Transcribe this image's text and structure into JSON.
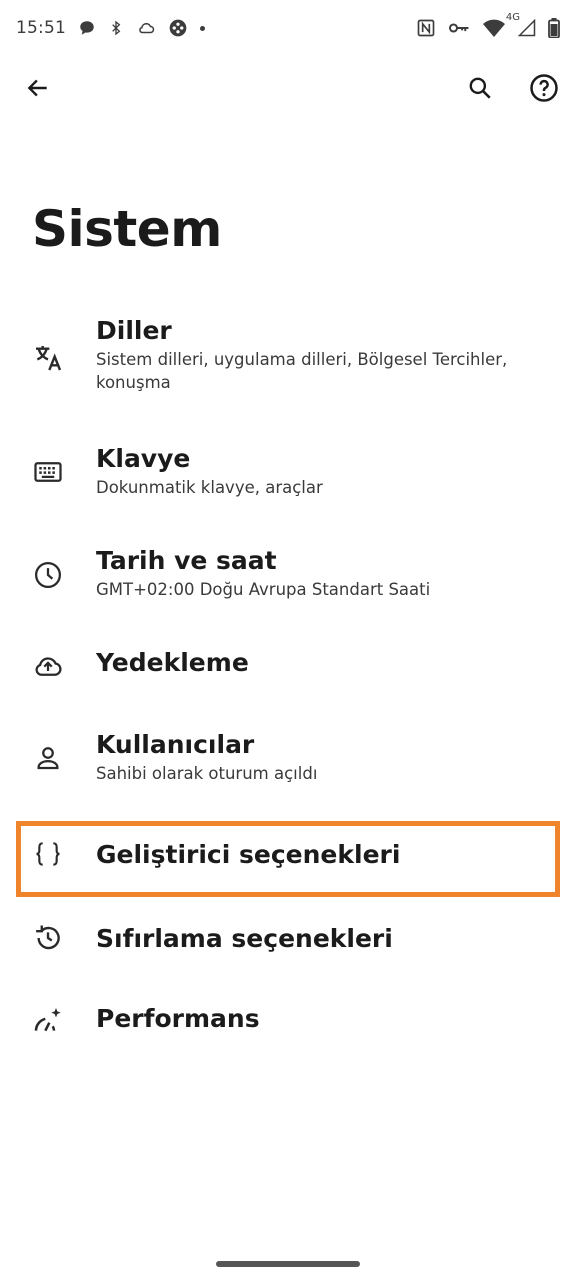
{
  "status_bar": {
    "time": "15:51",
    "left_icons": [
      "chat-bubble-icon",
      "bluetooth-icon",
      "cloud-icon",
      "game-controller-icon",
      "dot-icon"
    ],
    "right_icons": [
      "nfc-icon",
      "vpn-key-icon",
      "wifi-icon",
      "battery-icon"
    ],
    "network": "4G"
  },
  "app_bar": {
    "back_icon": "arrow-back-icon",
    "search_icon": "search-icon",
    "help_icon": "help-circle-icon"
  },
  "page": {
    "title": "Sistem"
  },
  "settings": [
    {
      "id": "diller",
      "icon": "translate-icon",
      "title": "Diller",
      "subtitle": "Sistem dilleri, uygulama dilleri, Bölgesel Tercihler, konuşma"
    },
    {
      "id": "klavye",
      "icon": "keyboard-icon",
      "title": "Klavye",
      "subtitle": "Dokunmatik klavye, araçlar"
    },
    {
      "id": "tarih",
      "icon": "clock-icon",
      "title": "Tarih ve saat",
      "subtitle": "GMT+02:00 Doğu Avrupa Standart Saati"
    },
    {
      "id": "yedekleme",
      "icon": "cloud-upload-icon",
      "title": "Yedekleme",
      "subtitle": ""
    },
    {
      "id": "kullanicilar",
      "icon": "person-icon",
      "title": "Kullanıcılar",
      "subtitle": "Sahibi olarak oturum açıldı"
    },
    {
      "id": "gelistirici",
      "icon": "code-braces-icon",
      "title": "Geliştirici seçenekleri",
      "subtitle": ""
    },
    {
      "id": "sifirlama",
      "icon": "history-icon",
      "title": "Sıfırlama seçenekleri",
      "subtitle": ""
    },
    {
      "id": "performans",
      "icon": "speed-sparkle-icon",
      "title": "Performans",
      "subtitle": ""
    }
  ],
  "colors": {
    "highlight": "#f0842a",
    "text": "#1b1b1b",
    "background": "#ffffff"
  }
}
